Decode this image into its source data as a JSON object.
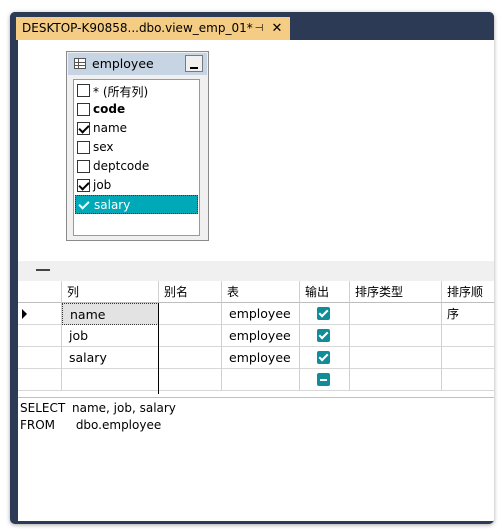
{
  "window": {
    "tab_title": "DESKTOP-K90858...dbo.view_emp_01*",
    "pin_glyph": "⊣",
    "close_glyph": "✕"
  },
  "diagram": {
    "table_name": "employee",
    "columns": [
      {
        "label": "* (所有列)",
        "checked": false,
        "bold": false,
        "selected": false
      },
      {
        "label": "code",
        "checked": false,
        "bold": true,
        "selected": false
      },
      {
        "label": "name",
        "checked": true,
        "bold": false,
        "selected": false
      },
      {
        "label": "sex",
        "checked": false,
        "bold": false,
        "selected": false
      },
      {
        "label": "deptcode",
        "checked": false,
        "bold": false,
        "selected": false
      },
      {
        "label": "job",
        "checked": true,
        "bold": false,
        "selected": false
      },
      {
        "label": "salary",
        "checked": true,
        "bold": false,
        "selected": true
      }
    ]
  },
  "grid": {
    "headers": [
      "列",
      "别名",
      "表",
      "输出",
      "排序类型",
      "排序顺序"
    ],
    "rows": [
      {
        "column": "name",
        "alias": "",
        "table": "employee",
        "output": "checked",
        "current": true
      },
      {
        "column": "job",
        "alias": "",
        "table": "employee",
        "output": "checked",
        "current": false
      },
      {
        "column": "salary",
        "alias": "",
        "table": "employee",
        "output": "checked",
        "current": false
      },
      {
        "column": "",
        "alias": "",
        "table": "",
        "output": "indeterminate",
        "current": false
      }
    ]
  },
  "sql": {
    "lines": [
      {
        "keyword": "SELECT",
        "text": "name, job, salary"
      },
      {
        "keyword": "FROM",
        "text": " dbo.employee"
      }
    ]
  },
  "colors": {
    "tab_active": "#f5cc84",
    "frame": "#2d3a55",
    "selection": "#00a9b7",
    "checkbox_teal": "#0f8e9a"
  }
}
